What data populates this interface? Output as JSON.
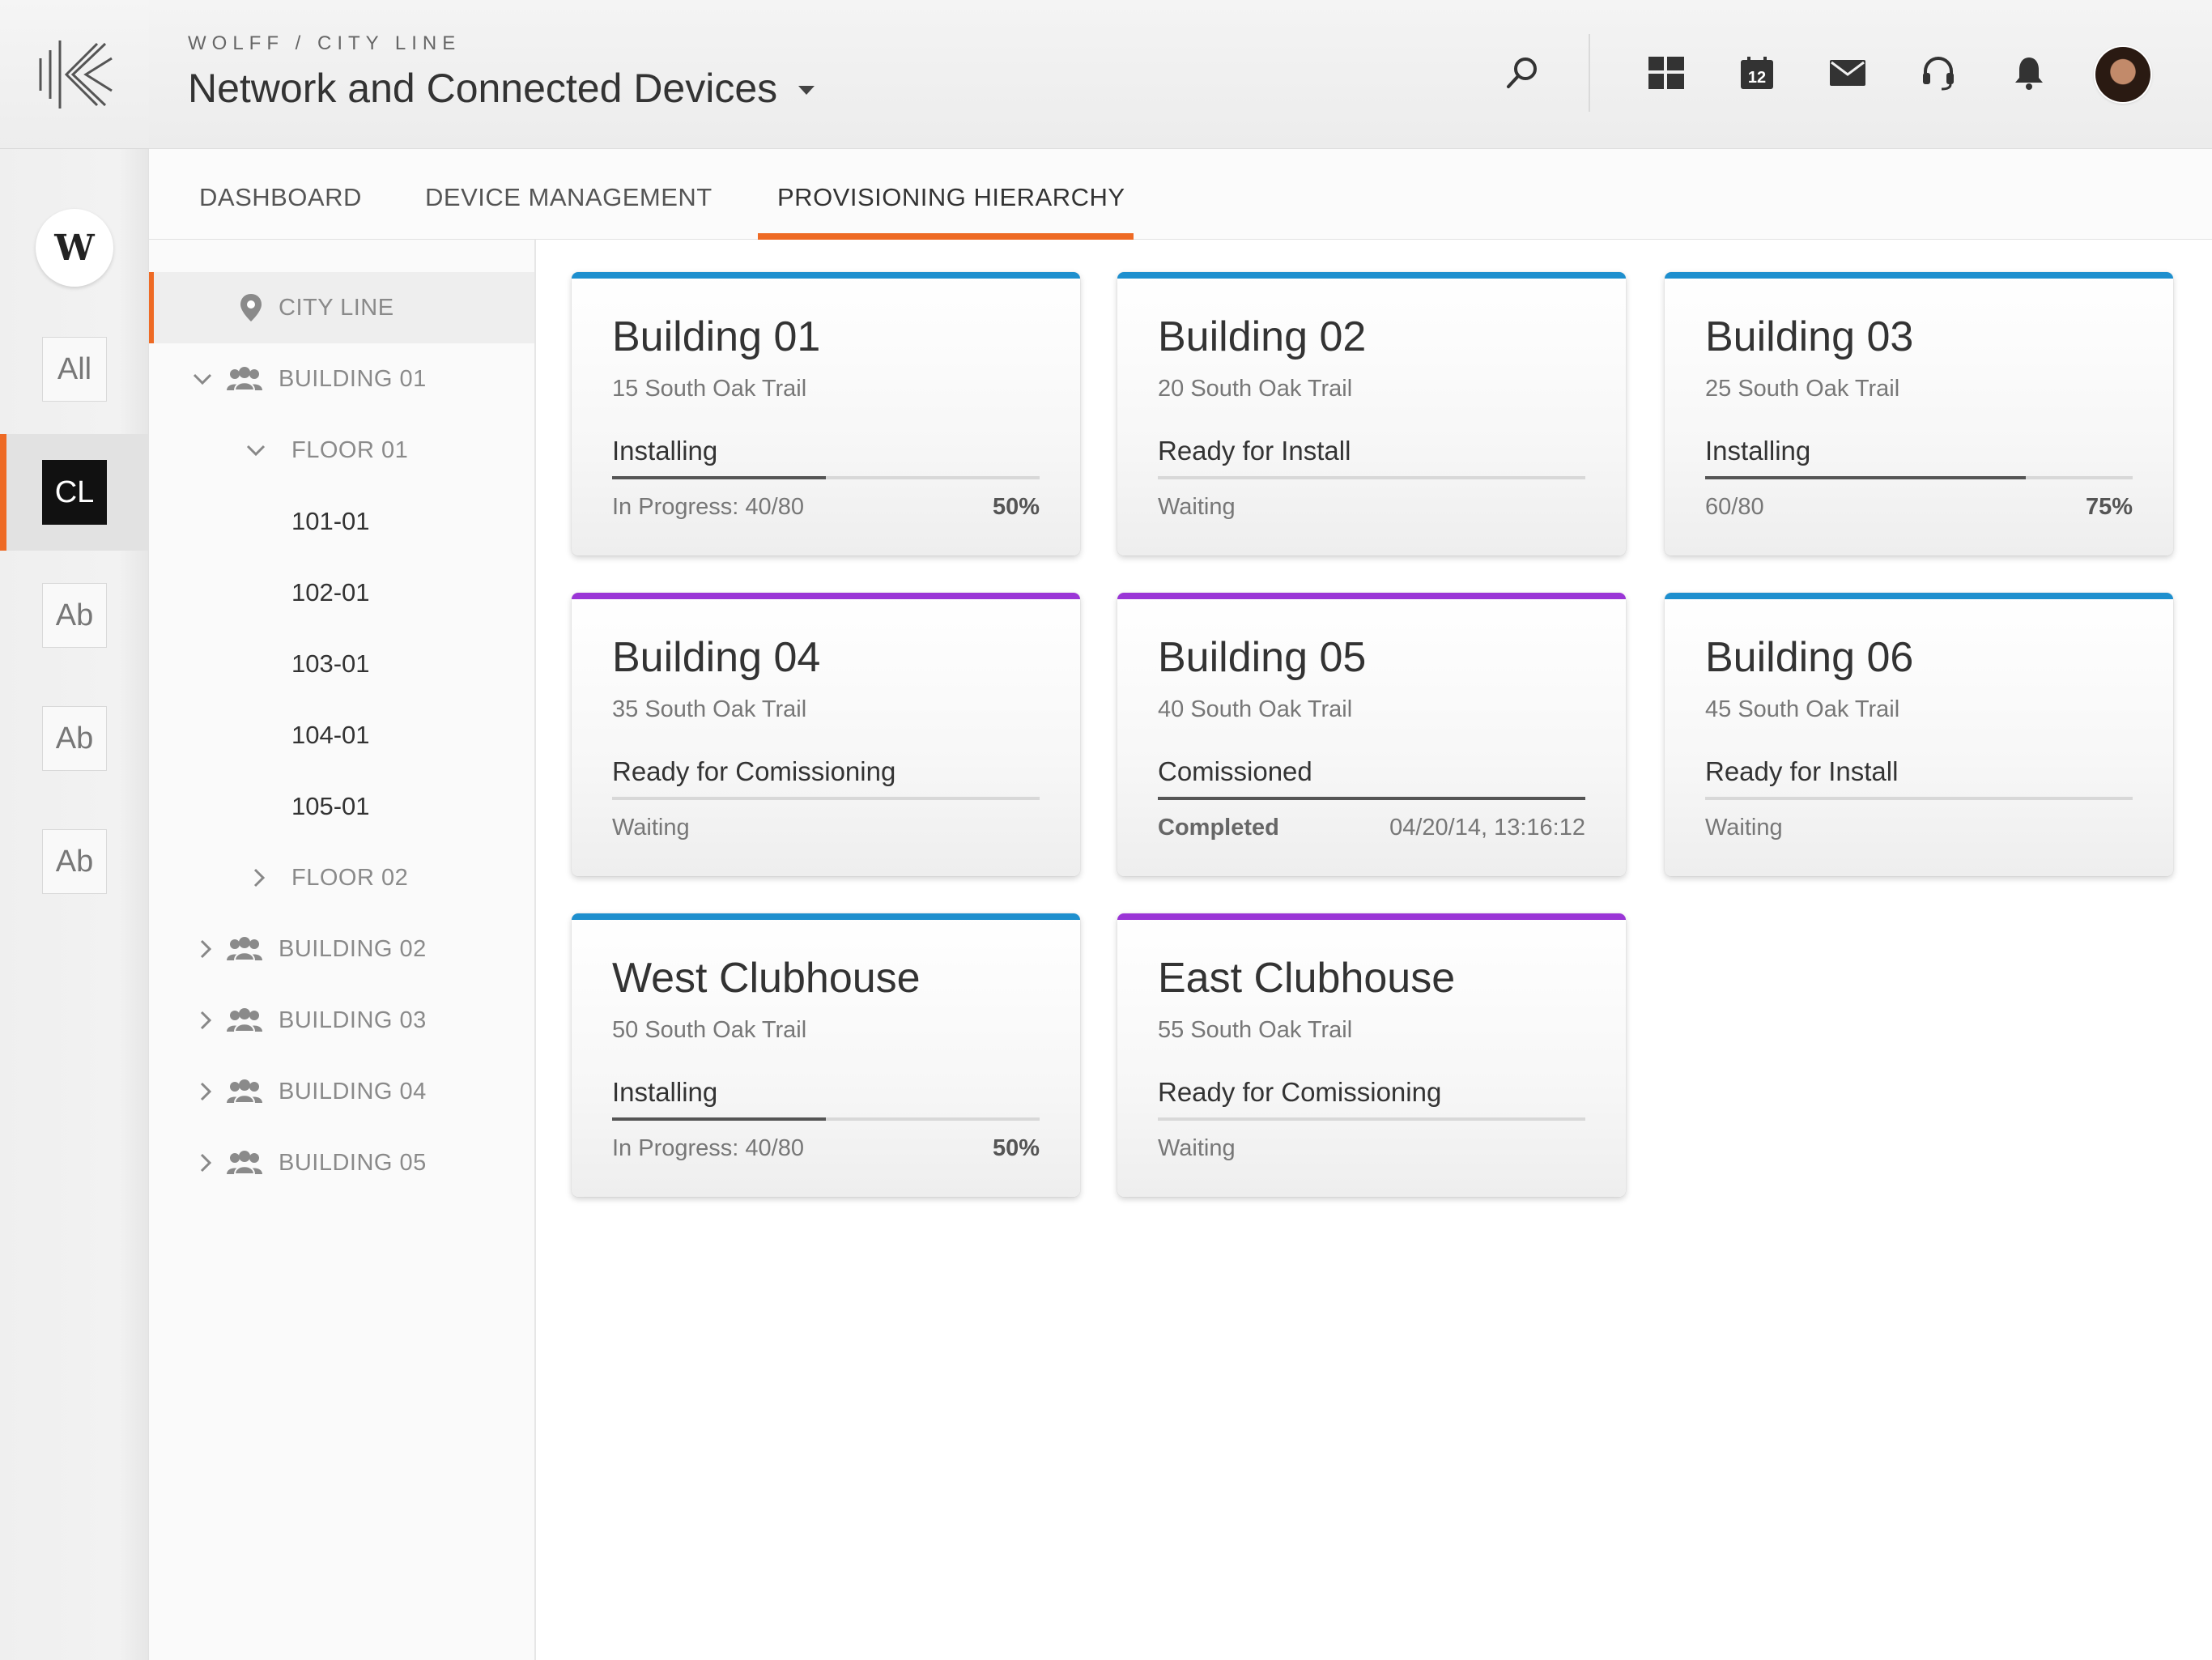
{
  "header": {
    "breadcrumb": "WOLFF / CITY LINE",
    "title": "Network and Connected Devices",
    "calendar_day": "12"
  },
  "rail": {
    "w_label": "W",
    "tiles": [
      "All",
      "CL",
      "Ab",
      "Ab",
      "Ab"
    ],
    "active_index": 1
  },
  "tabs": [
    {
      "label": "DASHBOARD"
    },
    {
      "label": "DEVICE MANAGEMENT"
    },
    {
      "label": "PROVISIONING HIERARCHY"
    }
  ],
  "active_tab": 2,
  "tree": {
    "root": "CITY LINE",
    "building_01": "BUILDING 01",
    "floor_01": "FLOOR 01",
    "units": [
      "101-01",
      "102-01",
      "103-01",
      "104-01",
      "105-01"
    ],
    "floor_02": "FLOOR 02",
    "other_buildings": [
      "BUILDING 02",
      "BUILDING 03",
      "BUILDING 04",
      "BUILDING 05"
    ]
  },
  "colors": {
    "accent": "#ee6a24",
    "blue": "#1e8fce",
    "purple": "#9a35d6"
  },
  "cards": [
    {
      "title": "Building 01",
      "address": "15 South Oak Trail",
      "status": "Installing",
      "progress": 0.5,
      "footer_left": "In Progress: 40/80",
      "footer_right": "50%",
      "top_color": "#1e8fce"
    },
    {
      "title": "Building 02",
      "address": "20 South Oak Trail",
      "status": "Ready for Install",
      "progress": 0,
      "footer_left": "Waiting",
      "footer_right": "",
      "top_color": "#1e8fce"
    },
    {
      "title": "Building 03",
      "address": "25 South Oak Trail",
      "status": "Installing",
      "progress": 0.75,
      "footer_left": "60/80",
      "footer_right": "75%",
      "top_color": "#1e8fce"
    },
    {
      "title": "Building 04",
      "address": "35 South Oak Trail",
      "status": "Ready for Comissioning",
      "progress": 0,
      "footer_left": "Waiting",
      "footer_right": "",
      "top_color": "#9a35d6"
    },
    {
      "title": "Building 05",
      "address": "40 South Oak Trail",
      "status": "Comissioned",
      "progress": 1,
      "footer_left": "Completed",
      "footer_right": "04/20/14, 13:16:12",
      "top_color": "#9a35d6"
    },
    {
      "title": "Building 06",
      "address": "45 South Oak Trail",
      "status": "Ready for Install",
      "progress": 0,
      "footer_left": "Waiting",
      "footer_right": "",
      "top_color": "#1e8fce"
    },
    {
      "title": "West Clubhouse",
      "address": "50 South Oak Trail",
      "status": "Installing",
      "progress": 0.5,
      "footer_left": "In Progress: 40/80",
      "footer_right": "50%",
      "top_color": "#1e8fce"
    },
    {
      "title": "East Clubhouse",
      "address": "55 South Oak Trail",
      "status": "Ready for Comissioning",
      "progress": 0,
      "footer_left": "Waiting",
      "footer_right": "",
      "top_color": "#9a35d6"
    }
  ]
}
